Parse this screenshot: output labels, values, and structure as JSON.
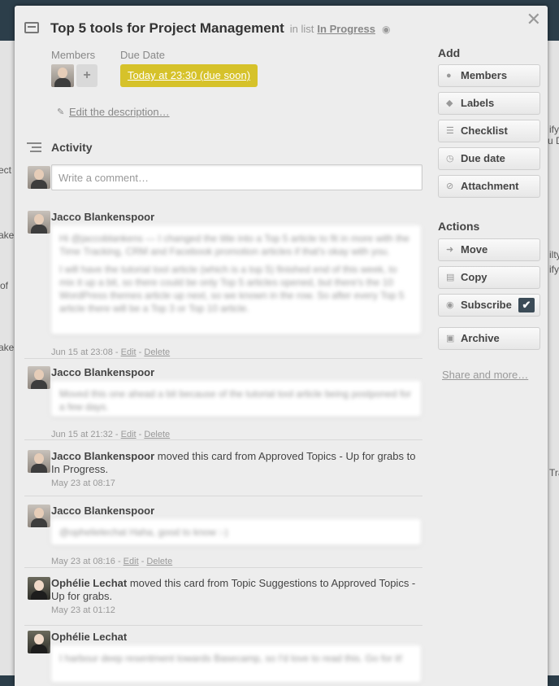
{
  "card": {
    "title": "Top 5 tools for Project Management",
    "in_list_prefix": "in list",
    "list_name": "In Progress",
    "members_label": "Members",
    "due_label": "Due Date",
    "due_value": "Today at 23:30 (due soon)",
    "edit_description": "Edit the description…"
  },
  "activity": {
    "heading": "Activity",
    "comment_placeholder": "Write a comment…",
    "items": [
      {
        "author": "Jacco Blankenspoor",
        "comment_lines": [
          "Hi @jaccoblankens — I changed the title into a Top 5 article to fit in more with the Time Tracking, CRM and Facebook promotion articles if that's okay with you.",
          "I will have the tutorial tool article (which is a top 5) finished end of this week, to mix it up a bit, so there could be only Top 5 articles opened, but there's the 10 WordPress themes article up next, so we known in the row. So after every Top 5 article there will be a Top 3 or Top 10 article."
        ],
        "date": "Jun 15 at 23:08",
        "edit": "Edit",
        "delete": "Delete"
      },
      {
        "author": "Jacco Blankenspoor",
        "comment_lines": [
          "Moved this one ahead a bit because of the tutorial tool article being postponed for a few days."
        ],
        "date": "Jun 15 at 21:32",
        "edit": "Edit",
        "delete": "Delete"
      },
      {
        "author": "Jacco Blankenspoor",
        "action": "moved this card from Approved Topics - Up for grabs to In Progress.",
        "date": "May 23 at 08:17"
      },
      {
        "author": "Jacco Blankenspoor",
        "comment_lines": [
          "@ophelielechat Haha, good to know :-)"
        ],
        "date": "May 23 at 08:16",
        "edit": "Edit",
        "delete": "Delete"
      },
      {
        "author": "Ophélie Lechat",
        "action": "moved this card from Topic Suggestions to Approved Topics - Up for grabs.",
        "date": "May 23 at 01:12"
      },
      {
        "author": "Ophélie Lechat",
        "comment_lines": [
          "I harbour deep resentment towards Basecamp, so I'd love to read this. Go for it!"
        ]
      }
    ],
    "separator": "-"
  },
  "sidebar": {
    "add_heading": "Add",
    "add_buttons": [
      {
        "label": "Members",
        "icon": "person-icon"
      },
      {
        "label": "Labels",
        "icon": "tag-icon"
      },
      {
        "label": "Checklist",
        "icon": "checklist-icon"
      },
      {
        "label": "Due date",
        "icon": "clock-icon"
      },
      {
        "label": "Attachment",
        "icon": "paperclip-icon"
      }
    ],
    "actions_heading": "Actions",
    "action_buttons": [
      {
        "label": "Move",
        "icon": "arrow-right-icon"
      },
      {
        "label": "Copy",
        "icon": "card-icon"
      },
      {
        "label": "Subscribe",
        "icon": "eye-icon"
      },
      {
        "label": "Archive",
        "icon": "archive-icon"
      }
    ],
    "share": "Share and more…"
  },
  "background": {
    "fragments": [
      "ect",
      "ake",
      "of",
      "ake",
      "ify",
      "u D",
      "ilty",
      "ify",
      "Tra"
    ]
  },
  "colors": {
    "due_soon": "#d6c22a",
    "backdrop": "#2c3e4a",
    "modal": "#ededed",
    "subscribe_check": "#3b4b57"
  }
}
